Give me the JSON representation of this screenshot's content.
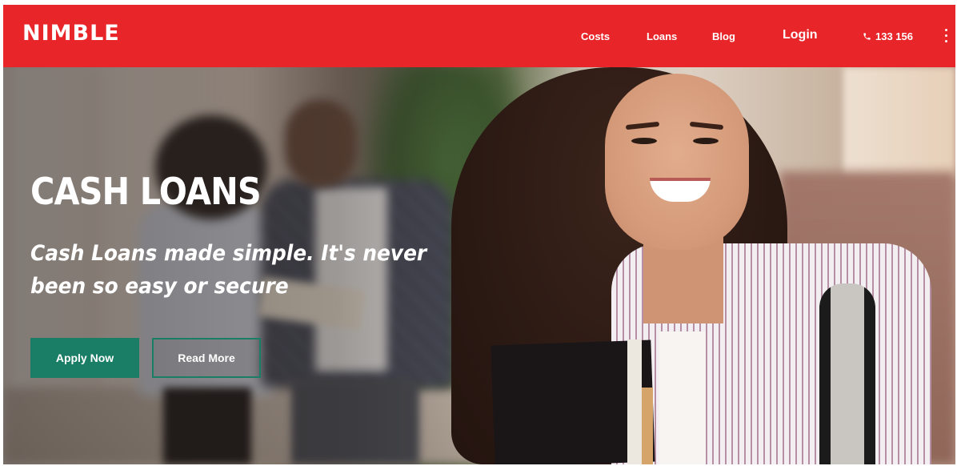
{
  "header": {
    "logo": "NIMBLE",
    "nav": {
      "costs": "Costs",
      "loans": "Loans",
      "blog": "Blog",
      "login": "Login"
    },
    "phone": "133 156",
    "colors": {
      "brand_red": "#e8262a"
    }
  },
  "hero": {
    "title": "CASH LOANS",
    "subtitle": "Cash Loans made simple. It's never been so easy or secure",
    "buttons": {
      "apply": "Apply Now",
      "read_more": "Read More"
    },
    "colors": {
      "button_green": "#1a7e66"
    }
  },
  "icons": {
    "phone": "phone-icon",
    "menu": "kebab-menu-icon"
  }
}
